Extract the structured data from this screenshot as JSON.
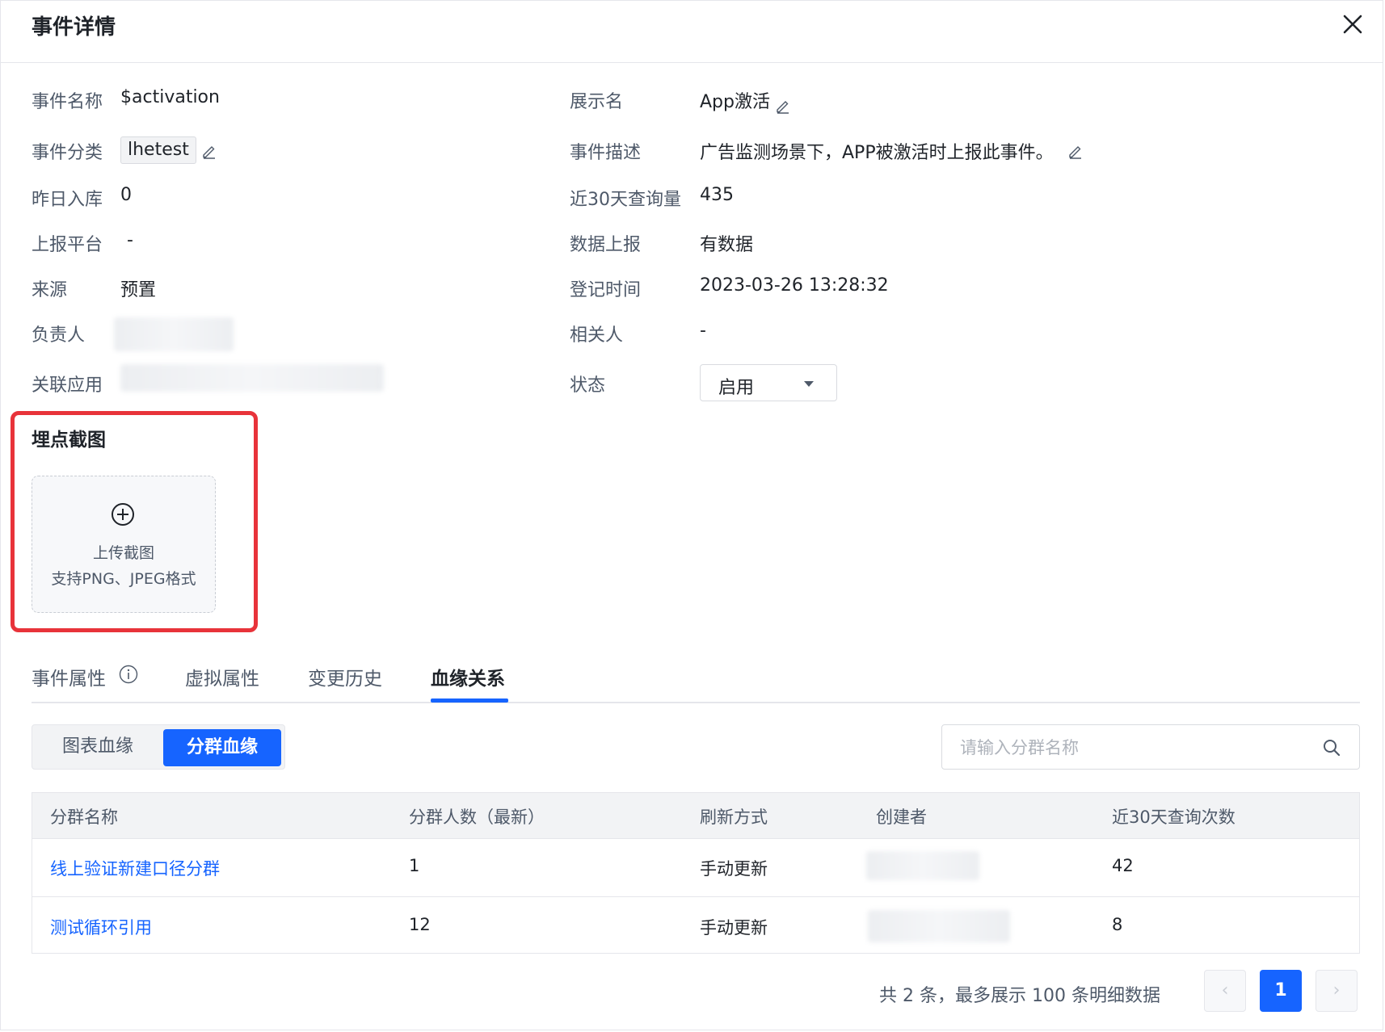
{
  "dialog": {
    "title": "事件详情"
  },
  "details": {
    "event_name_label": "事件名称",
    "event_name_value": "$activation",
    "display_name_label": "展示名",
    "display_name_value": "App激活",
    "category_label": "事件分类",
    "category_value": "lhetest",
    "description_label": "事件描述",
    "description_value": "广告监测场景下，APP被激活时上报此事件。",
    "yesterday_label": "昨日入库",
    "yesterday_value": "0",
    "query_30d_label": "近30天查询量",
    "query_30d_value": "435",
    "platform_label": "上报平台",
    "platform_value": "-",
    "data_report_label": "数据上报",
    "data_report_value": "有数据",
    "source_label": "来源",
    "source_value": "预置",
    "register_time_label": "登记时间",
    "register_time_value": "2023-03-26 13:28:32",
    "owner_label": "负责人",
    "related_person_label": "相关人",
    "related_person_value": "-",
    "related_app_label": "关联应用",
    "status_label": "状态",
    "status_value": "启用"
  },
  "screenshot_section": {
    "title": "埋点截图",
    "upload_label": "上传截图",
    "upload_hint": "支持PNG、JPEG格式"
  },
  "tabs": [
    {
      "label": "事件属性"
    },
    {
      "label": "虚拟属性"
    },
    {
      "label": "变更历史"
    },
    {
      "label": "血缘关系"
    }
  ],
  "segment": {
    "option1": "图表血缘",
    "option2": "分群血缘"
  },
  "search": {
    "placeholder": "请输入分群名称"
  },
  "table": {
    "columns": [
      "分群名称",
      "分群人数（最新）",
      "刷新方式",
      "创建者",
      "近30天查询次数"
    ],
    "rows": [
      {
        "name": "线上验证新建口径分群",
        "count": "1",
        "refresh": "手动更新",
        "queries": "42"
      },
      {
        "name": "测试循环引用",
        "count": "12",
        "refresh": "手动更新",
        "queries": "8"
      }
    ]
  },
  "pagination": {
    "summary": "共 2 条，最多展示 100 条明细数据",
    "current_page": "1",
    "prev": "‹",
    "next": "›"
  },
  "colors": {
    "primary": "#1664ff",
    "highlight_border": "#e8333a"
  }
}
